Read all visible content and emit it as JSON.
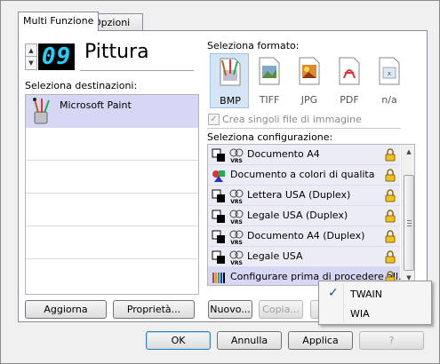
{
  "tabs": [
    "Multi Funzione",
    "Opzioni"
  ],
  "profile": {
    "number": "09",
    "name": "Pittura"
  },
  "destinations": {
    "label": "Seleziona destinazioni:",
    "items": [
      "Microsoft Paint"
    ]
  },
  "formats": {
    "label": "Seleziona formato:",
    "items": [
      {
        "name": "BMP",
        "icon": "bmp-file-icon",
        "selected": true
      },
      {
        "name": "TIFF",
        "icon": "tiff-file-icon",
        "selected": false
      },
      {
        "name": "JPG",
        "icon": "jpg-file-icon",
        "selected": false
      },
      {
        "name": "PDF",
        "icon": "pdf-file-icon",
        "selected": false
      },
      {
        "name": "n/a",
        "icon": "na-file-icon",
        "selected": false
      }
    ],
    "single_files_label": "Crea singoli file di immagine"
  },
  "configurations": {
    "label": "Seleziona configurazione:",
    "items": [
      {
        "label": "Documento A4",
        "vrs": true
      },
      {
        "label": "Documento a colori di qualita",
        "vrs": false
      },
      {
        "label": "Lettera USA (Duplex)",
        "vrs": true
      },
      {
        "label": "Legale USA (Duplex)",
        "vrs": true
      },
      {
        "label": "Documento A4 (Duplex)",
        "vrs": true
      },
      {
        "label": "Legale USA",
        "vrs": true
      },
      {
        "label": "Configurare prima di procedere all...",
        "vrs": false,
        "selected": true
      }
    ]
  },
  "buttons": {
    "refresh": "Aggiorna",
    "properties": "Proprietà...",
    "new": "Nuovo...",
    "copy": "Copia...",
    "ok": "OK",
    "cancel": "Annulla",
    "apply": "Applica",
    "help": "?"
  },
  "context_menu": {
    "items": [
      "TWAIN",
      "WIA"
    ],
    "checked": "TWAIN"
  },
  "colors": {
    "selection": "#d6d6f5",
    "digits": "#20d0ff"
  }
}
